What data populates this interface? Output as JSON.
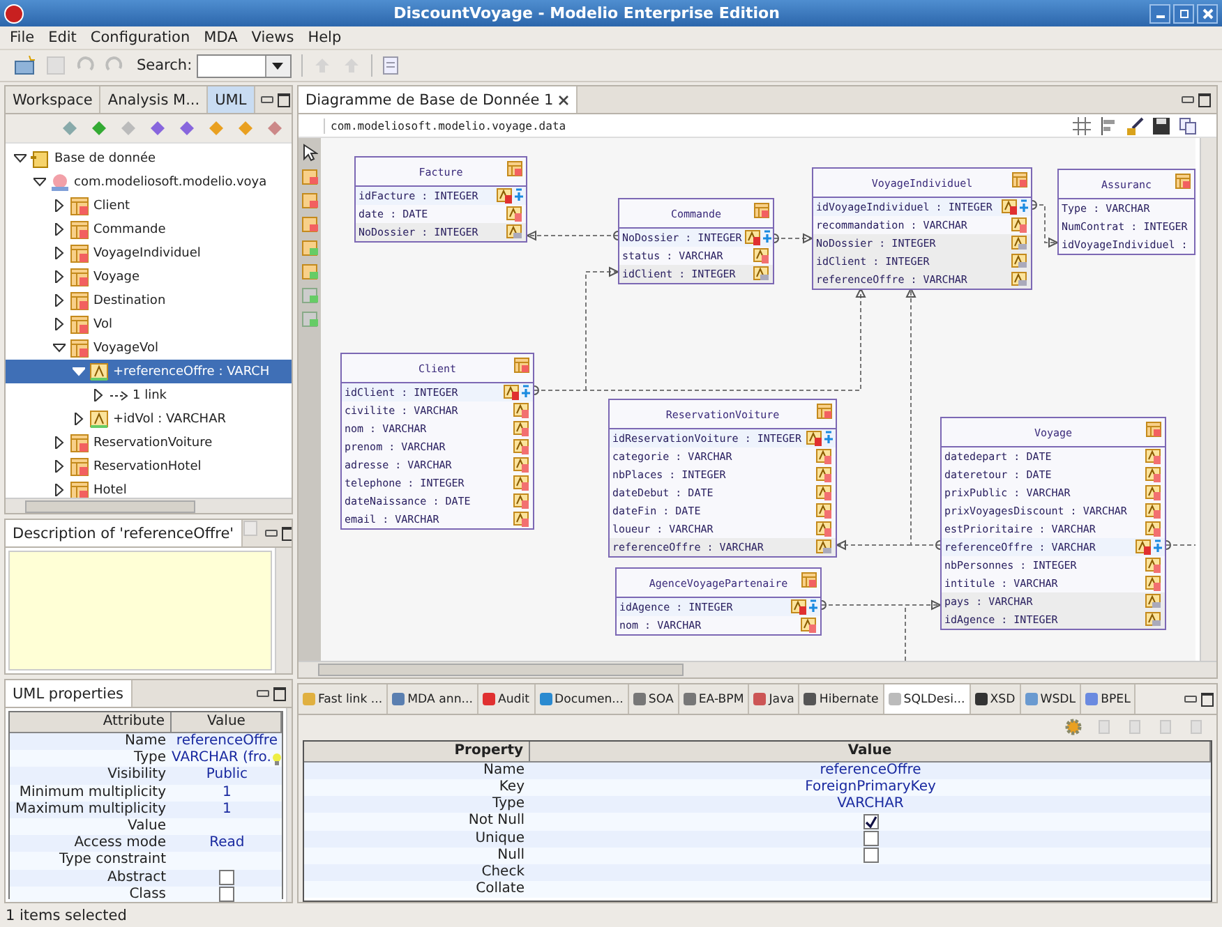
{
  "window": {
    "title": "DiscountVoyage - Modelio Enterprise Edition"
  },
  "menu": [
    "File",
    "Edit",
    "Configuration",
    "MDA",
    "Views",
    "Help"
  ],
  "toolbar": {
    "search_label": "Search:"
  },
  "explorer": {
    "tabs": [
      {
        "label": "Workspace",
        "selected": false
      },
      {
        "label": "Analysis M...",
        "selected": false
      },
      {
        "label": "UML",
        "selected": true
      }
    ],
    "tree": [
      {
        "label": "Base de donnée",
        "kind": "package",
        "expanded": true,
        "selected": false,
        "children": [
          {
            "label": "com.modeliosoft.modelio.voya",
            "kind": "model",
            "expanded": true,
            "selected": false,
            "children": [
              {
                "label": "Client",
                "kind": "table",
                "expanded": false,
                "selected": false
              },
              {
                "label": "Commande",
                "kind": "table",
                "expanded": false,
                "selected": false
              },
              {
                "label": "VoyageIndividuel",
                "kind": "table",
                "expanded": false,
                "selected": false
              },
              {
                "label": "Voyage",
                "kind": "table",
                "expanded": false,
                "selected": false
              },
              {
                "label": "Destination",
                "kind": "table",
                "expanded": false,
                "selected": false
              },
              {
                "label": "Vol",
                "kind": "table",
                "expanded": false,
                "selected": false
              },
              {
                "label": "VoyageVol",
                "kind": "table",
                "expanded": true,
                "selected": false,
                "children": [
                  {
                    "label": "+referenceOffre : VARCH",
                    "kind": "attribute",
                    "expanded": true,
                    "selected": true,
                    "children": [
                      {
                        "label": "1 link",
                        "kind": "link",
                        "expanded": false,
                        "selected": false
                      }
                    ]
                  },
                  {
                    "label": "+idVol : VARCHAR",
                    "kind": "attribute",
                    "expanded": false,
                    "selected": false
                  }
                ]
              },
              {
                "label": "ReservationVoiture",
                "kind": "table",
                "expanded": false,
                "selected": false
              },
              {
                "label": "ReservationHotel",
                "kind": "table",
                "expanded": false,
                "selected": false
              },
              {
                "label": "Hotel",
                "kind": "table",
                "expanded": false,
                "selected": false
              }
            ]
          }
        ]
      }
    ]
  },
  "description": {
    "title": "Description of 'referenceOffre'"
  },
  "uml_properties": {
    "title": "UML properties",
    "columns": [
      "Attribute",
      "Value"
    ],
    "rows": [
      {
        "attribute": "Name",
        "kind": "text",
        "value": "referenceOffre"
      },
      {
        "attribute": "Type",
        "kind": "text",
        "value": "VARCHAR (fro."
      },
      {
        "attribute": "Visibility",
        "kind": "text",
        "value": "Public"
      },
      {
        "attribute": "Minimum multiplicity",
        "kind": "text",
        "value": "1"
      },
      {
        "attribute": "Maximum multiplicity",
        "kind": "text",
        "value": "1"
      },
      {
        "attribute": "Value",
        "kind": "text"
      },
      {
        "attribute": "Access mode",
        "kind": "text",
        "value": "Read"
      },
      {
        "attribute": "Type constraint",
        "kind": "text"
      },
      {
        "attribute": "Abstract",
        "kind": "checkbox",
        "checked": false
      },
      {
        "attribute": "Class",
        "kind": "checkbox",
        "checked": false
      }
    ]
  },
  "editor": {
    "tab": "Diagramme de Base de Donnée 1",
    "breadcrumb": "com.modeliosoft.modelio.voyage.data",
    "tables": [
      {
        "name": "Facture",
        "columns": [
          {
            "label": "idFacture : INTEGER",
            "kind": "pk"
          },
          {
            "label": "date : DATE",
            "kind": "column"
          },
          {
            "label": "NoDossier : INTEGER",
            "kind": "fk"
          }
        ]
      },
      {
        "name": "Commande",
        "columns": [
          {
            "label": "NoDossier : INTEGER",
            "kind": "pk"
          },
          {
            "label": "status : VARCHAR",
            "kind": "column"
          },
          {
            "label": "idClient : INTEGER",
            "kind": "fk"
          }
        ]
      },
      {
        "name": "VoyageIndividuel",
        "columns": [
          {
            "label": "idVoyageIndividuel : INTEGER",
            "kind": "pk"
          },
          {
            "label": "recommandation : VARCHAR",
            "kind": "column"
          },
          {
            "label": "NoDossier : INTEGER",
            "kind": "fk"
          },
          {
            "label": "idClient : INTEGER",
            "kind": "fk"
          },
          {
            "label": "referenceOffre : VARCHAR",
            "kind": "fk"
          }
        ]
      },
      {
        "name": "Assuranc",
        "columns": [
          {
            "label": "Type : VARCHAR",
            "kind": "none"
          },
          {
            "label": "NumContrat : INTEGER",
            "kind": "none"
          },
          {
            "label": "idVoyageIndividuel :",
            "kind": "none"
          }
        ]
      },
      {
        "name": "Client",
        "columns": [
          {
            "label": "idClient : INTEGER",
            "kind": "pk"
          },
          {
            "label": "civilite : VARCHAR",
            "kind": "column"
          },
          {
            "label": "nom : VARCHAR",
            "kind": "column"
          },
          {
            "label": "prenom : VARCHAR",
            "kind": "column"
          },
          {
            "label": "adresse : VARCHAR",
            "kind": "column"
          },
          {
            "label": "telephone : INTEGER",
            "kind": "column"
          },
          {
            "label": "dateNaissance : DATE",
            "kind": "column"
          },
          {
            "label": "email : VARCHAR",
            "kind": "column"
          }
        ]
      },
      {
        "name": "ReservationVoiture",
        "columns": [
          {
            "label": "idReservationVoiture : INTEGER",
            "kind": "pk"
          },
          {
            "label": "categorie : VARCHAR",
            "kind": "column"
          },
          {
            "label": "nbPlaces : INTEGER",
            "kind": "column"
          },
          {
            "label": "dateDebut : DATE",
            "kind": "column"
          },
          {
            "label": "dateFin : DATE",
            "kind": "column"
          },
          {
            "label": "loueur : VARCHAR",
            "kind": "column"
          },
          {
            "label": "referenceOffre : VARCHAR",
            "kind": "fk"
          }
        ]
      },
      {
        "name": "AgenceVoyagePartenaire",
        "columns": [
          {
            "label": "idAgence : INTEGER",
            "kind": "pk"
          },
          {
            "label": "nom : VARCHAR",
            "kind": "column"
          }
        ]
      },
      {
        "name": "Voyage",
        "columns": [
          {
            "label": "datedepart : DATE",
            "kind": "column"
          },
          {
            "label": "dateretour : DATE",
            "kind": "column"
          },
          {
            "label": "prixPublic : VARCHAR",
            "kind": "column"
          },
          {
            "label": "prixVoyagesDiscount : VARCHAR",
            "kind": "column"
          },
          {
            "label": "estPrioritaire : VARCHAR",
            "kind": "column"
          },
          {
            "label": "referenceOffre : VARCHAR",
            "kind": "pk"
          },
          {
            "label": "nbPersonnes : INTEGER",
            "kind": "column"
          },
          {
            "label": "intitule : VARCHAR",
            "kind": "column"
          },
          {
            "label": "pays : VARCHAR",
            "kind": "fk"
          },
          {
            "label": "idAgence : INTEGER",
            "kind": "fk"
          }
        ]
      }
    ]
  },
  "bottom": {
    "tabs": [
      {
        "label": "Fast link ...",
        "selected": false
      },
      {
        "label": "MDA ann...",
        "selected": false
      },
      {
        "label": "Audit",
        "selected": false
      },
      {
        "label": "Documen...",
        "selected": false
      },
      {
        "label": "SOA",
        "selected": false
      },
      {
        "label": "EA-BPM",
        "selected": false
      },
      {
        "label": "Java",
        "selected": false
      },
      {
        "label": "Hibernate",
        "selected": false
      },
      {
        "label": "SQLDesi...",
        "selected": true
      },
      {
        "label": "XSD",
        "selected": false
      },
      {
        "label": "WSDL",
        "selected": false
      },
      {
        "label": "BPEL",
        "selected": false
      }
    ],
    "columns": [
      "Property",
      "Value"
    ],
    "rows": [
      {
        "property": "Name",
        "kind": "text",
        "value": "referenceOffre"
      },
      {
        "property": "Key",
        "kind": "text",
        "value": "ForeignPrimaryKey"
      },
      {
        "property": "Type",
        "kind": "text",
        "value": "VARCHAR"
      },
      {
        "property": "Not Null",
        "kind": "checkbox",
        "checked": true
      },
      {
        "property": "Unique",
        "kind": "checkbox",
        "checked": false
      },
      {
        "property": "Null",
        "kind": "checkbox",
        "checked": false
      },
      {
        "property": "Check",
        "kind": "text"
      },
      {
        "property": "Collate",
        "kind": "text"
      }
    ]
  },
  "status_bar": "1 items selected"
}
